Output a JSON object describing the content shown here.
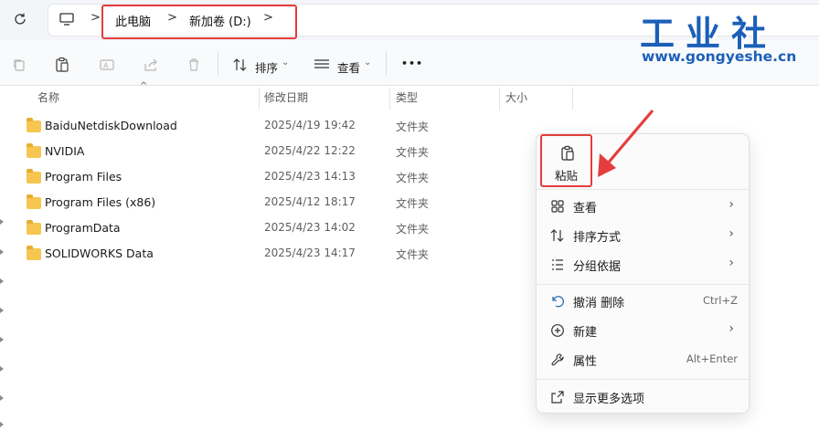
{
  "address": {
    "crumbs": [
      "此电脑",
      "新加卷 (D:)"
    ],
    "separator": ">"
  },
  "toolbar": {
    "sort_label": "排序",
    "view_label": "查看",
    "more_label": "•••"
  },
  "columns": {
    "name": "名称",
    "date": "修改日期",
    "type": "类型",
    "size": "大小"
  },
  "files": [
    {
      "name": "BaiduNetdiskDownload",
      "date": "2025/4/19 19:42",
      "type": "文件夹"
    },
    {
      "name": "NVIDIA",
      "date": "2025/4/22 12:22",
      "type": "文件夹"
    },
    {
      "name": "Program Files",
      "date": "2025/4/23 14:13",
      "type": "文件夹"
    },
    {
      "name": "Program Files (x86)",
      "date": "2025/4/12 18:17",
      "type": "文件夹"
    },
    {
      "name": "ProgramData",
      "date": "2025/4/23 14:02",
      "type": "文件夹"
    },
    {
      "name": "SOLIDWORKS Data",
      "date": "2025/4/23 14:17",
      "type": "文件夹"
    }
  ],
  "context_menu": {
    "paste_label": "粘贴",
    "items": [
      {
        "label": "查看",
        "icon": "grid-view-icon",
        "submenu": true
      },
      {
        "label": "排序方式",
        "icon": "sort-icon",
        "submenu": true
      },
      {
        "label": "分组依据",
        "icon": "group-by-icon",
        "submenu": true
      },
      {
        "label": "撤消 删除",
        "icon": "undo-icon",
        "shortcut": "Ctrl+Z"
      },
      {
        "label": "新建",
        "icon": "new-icon",
        "submenu": true
      },
      {
        "label": "属性",
        "icon": "wrench-icon",
        "shortcut": "Alt+Enter"
      },
      {
        "label": "显示更多选项",
        "icon": "more-options-icon"
      }
    ]
  },
  "watermark": {
    "brand": "工业社",
    "url": "www.gongyeshe.cn"
  },
  "colors": {
    "highlight": "#e53d3d",
    "folder": "#f6c650",
    "watermark": "#1b5fb8"
  }
}
